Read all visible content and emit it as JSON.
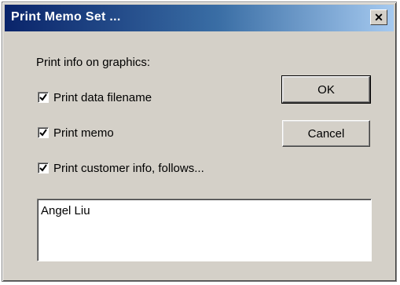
{
  "window": {
    "title": "Print Memo Set ...",
    "close_glyph": "✕"
  },
  "section_label": "Print info on graphics:",
  "checkboxes": [
    {
      "label": "Print data filename",
      "checked": true
    },
    {
      "label": "Print memo",
      "checked": true
    },
    {
      "label": "Print customer info, follows...",
      "checked": true
    }
  ],
  "buttons": {
    "ok_label": "OK",
    "cancel_label": "Cancel"
  },
  "customer_info": {
    "value": "Angel Liu"
  }
}
